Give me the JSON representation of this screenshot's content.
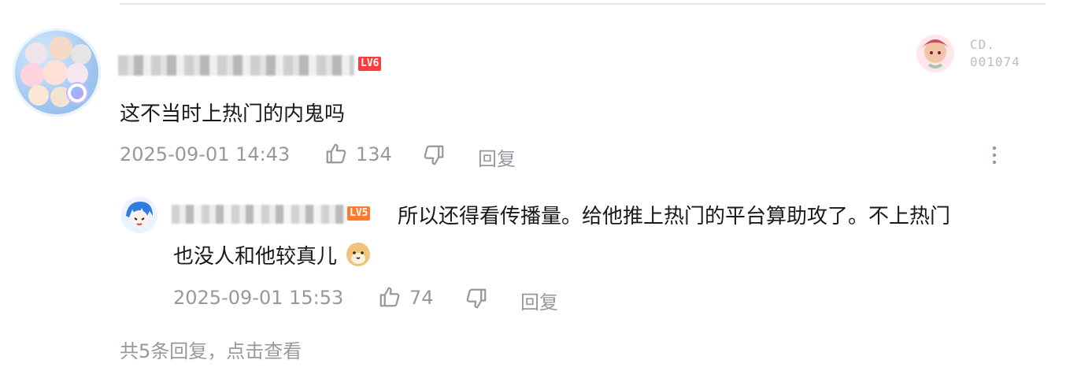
{
  "comment": {
    "level_badge": "LV6",
    "content": "这不当时上热门的内鬼吗",
    "timestamp": "2025-09-01 14:43",
    "like_count": "134",
    "reply_label": "回复",
    "decor_text": "CD.\n001074",
    "icons": [
      "like-icon",
      "dislike-icon",
      "more-vertical-icon"
    ]
  },
  "reply": {
    "level_badge": "LV5",
    "content_line1": "所以还得看传播量。给他推上热门的平台算助攻了。不上热门",
    "content_line2": "也没人和他较真儿",
    "emoji": "doge-emoji",
    "timestamp": "2025-09-01 15:53",
    "like_count": "74",
    "reply_label": "回复"
  },
  "more_replies_text": "共5条回复，点击查看",
  "colors": {
    "text": "#18191c",
    "meta": "#9499a0",
    "lv6": "#ff3b3b",
    "lv5": "#ff7a2b",
    "divider": "#e3e5e7"
  }
}
